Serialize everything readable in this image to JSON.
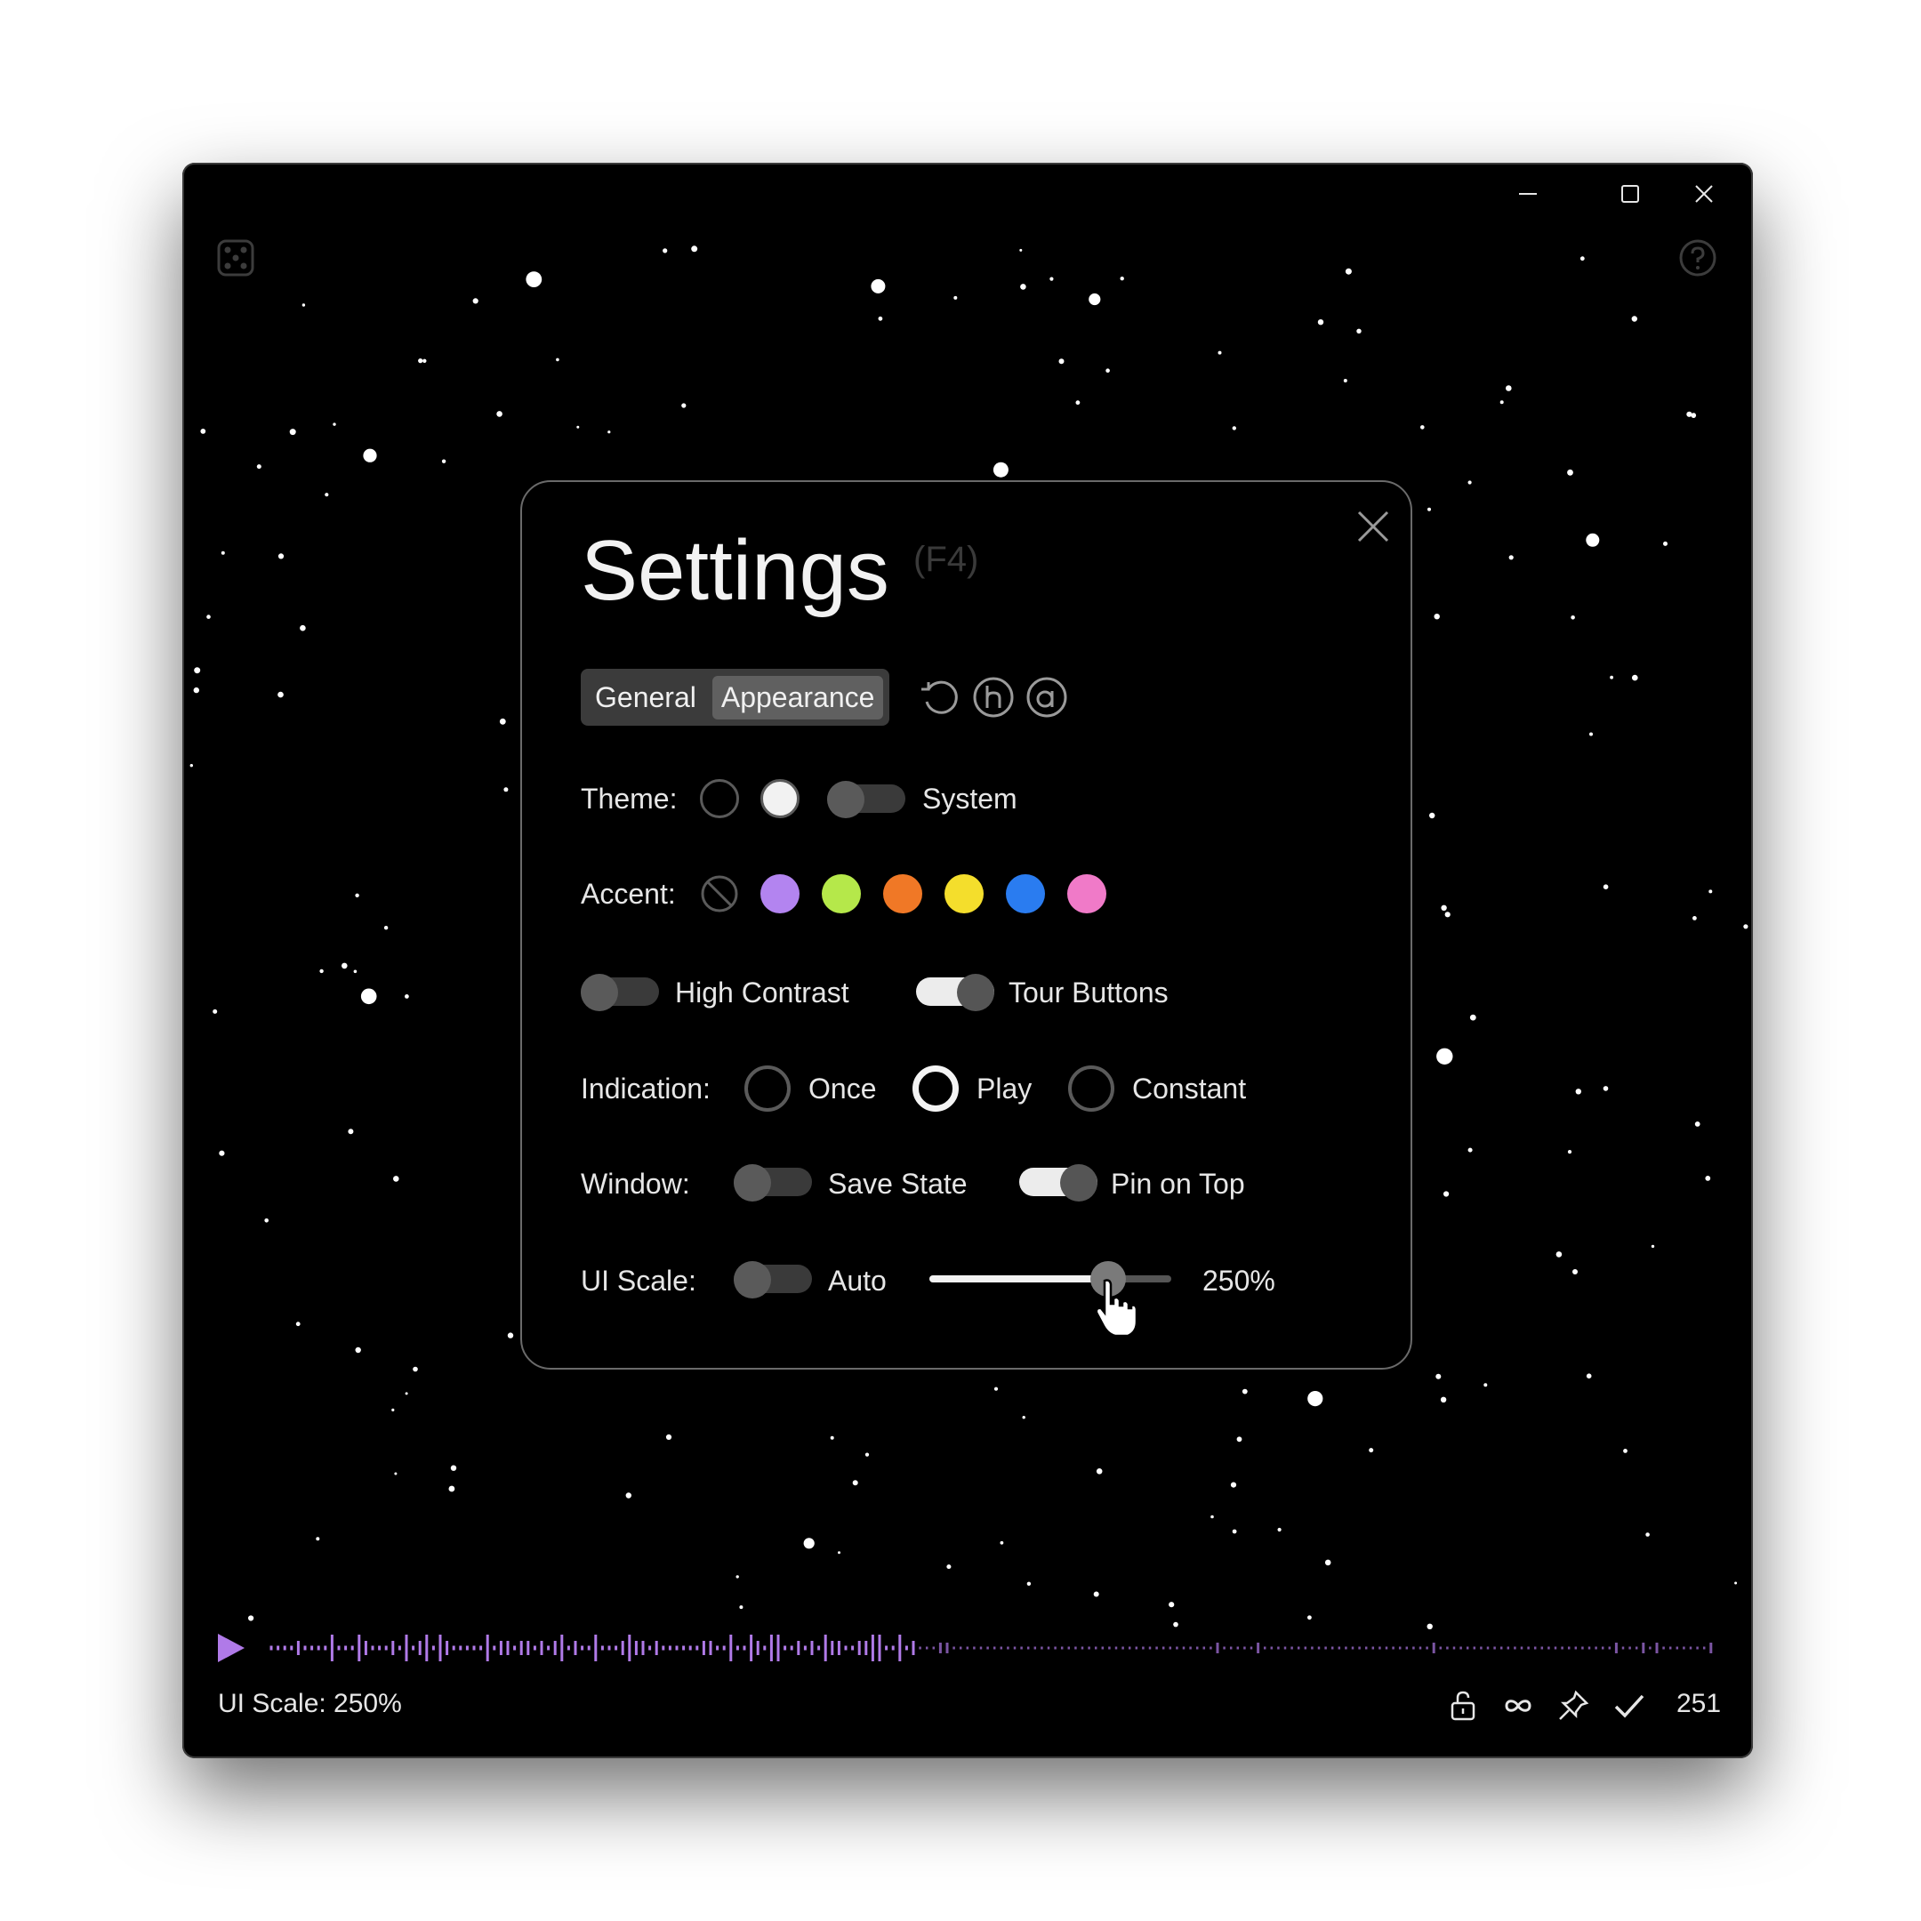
{
  "window": {
    "caption_buttons": [
      "minimize-icon",
      "maximize-icon",
      "close-icon"
    ],
    "corner_icons": [
      "dice-icon",
      "help-icon"
    ]
  },
  "settings": {
    "title": "Settings",
    "hotkey": "(F4)",
    "tabs": [
      {
        "label": "General",
        "active": false
      },
      {
        "label": "Appearance",
        "active": true
      }
    ],
    "tool_icons": [
      "reset-icon",
      "circled-h-icon",
      "circled-a-icon"
    ],
    "theme": {
      "label": "Theme:",
      "options": [
        "dark",
        "light"
      ],
      "system_label": "System",
      "system_on": false
    },
    "accent": {
      "label": "Accent:",
      "colors": [
        "none",
        "#b384f0",
        "#b5e84a",
        "#f07826",
        "#f4de2c",
        "#2a7cf0",
        "#f07ac8"
      ]
    },
    "high_contrast": {
      "label": "High Contrast",
      "on": false
    },
    "tour_buttons": {
      "label": "Tour Buttons",
      "on": true
    },
    "indication": {
      "label": "Indication:",
      "options": [
        "Once",
        "Play",
        "Constant"
      ],
      "selected": "Play"
    },
    "window_opts": {
      "label": "Window:",
      "save_state": {
        "label": "Save State",
        "on": false
      },
      "pin_on_top": {
        "label": "Pin on Top",
        "on": true
      }
    },
    "ui_scale": {
      "label": "UI Scale:",
      "auto_label": "Auto",
      "auto_on": false,
      "value_text": "250%",
      "slider_fraction": 0.74
    }
  },
  "statusbar": {
    "left_text": "UI Scale: 250%",
    "icons": [
      "unlock-icon",
      "infinity-icon",
      "pin-icon",
      "check-icon"
    ],
    "count": "251"
  },
  "colors": {
    "accent_purple": "#b07ae8",
    "panel_border": "#6a6a6a"
  }
}
